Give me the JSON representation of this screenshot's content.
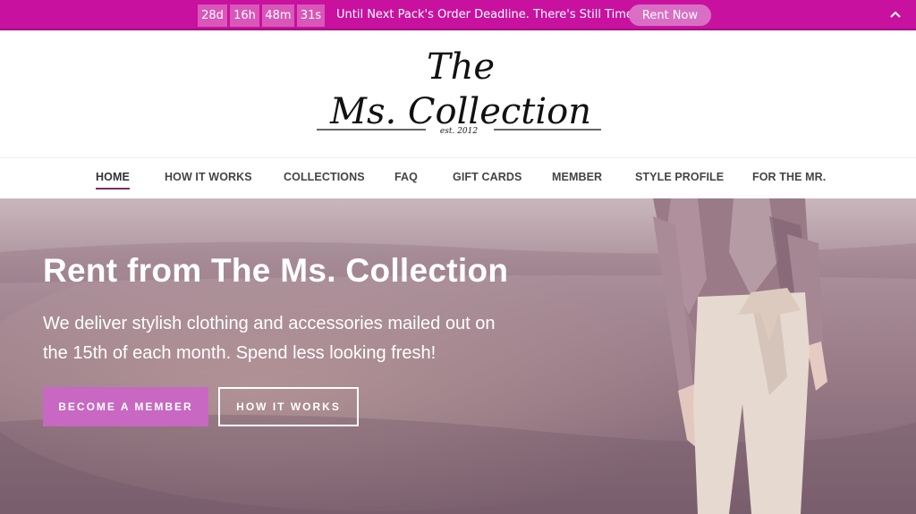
{
  "topbar": {
    "timer": [
      "28d",
      "16h",
      "48m",
      "31s"
    ],
    "message": "Until Next Pack's Order Deadline. There's Still Time.",
    "cta": "Rent Now",
    "icons": {
      "collapse": "chevron-up-icon"
    },
    "colors": {
      "background": "#c8119f",
      "timer_cell": "#d957b8",
      "cta": "#d96fc4"
    }
  },
  "logo": {
    "line1": "The",
    "line2": "Ms. Collection",
    "est": "est. 2012"
  },
  "nav": {
    "items": [
      {
        "label": "HOME",
        "active": true
      },
      {
        "label": "HOW IT WORKS"
      },
      {
        "label": "COLLECTIONS"
      },
      {
        "label": "FAQ"
      },
      {
        "label": "GIFT CARDS"
      },
      {
        "label": "MEMBER"
      },
      {
        "label": "STYLE PROFILE"
      },
      {
        "label": "FOR THE MR."
      }
    ]
  },
  "hero": {
    "title": "Rent from The Ms. Collection",
    "subtitle": "We deliver stylish clothing and accessories mailed out on the 15th of each month. Spend less looking fresh!",
    "primary_button": "BECOME A MEMBER",
    "secondary_button": "HOW IT WORKS",
    "colors": {
      "primary_button": "#c868c2"
    }
  }
}
